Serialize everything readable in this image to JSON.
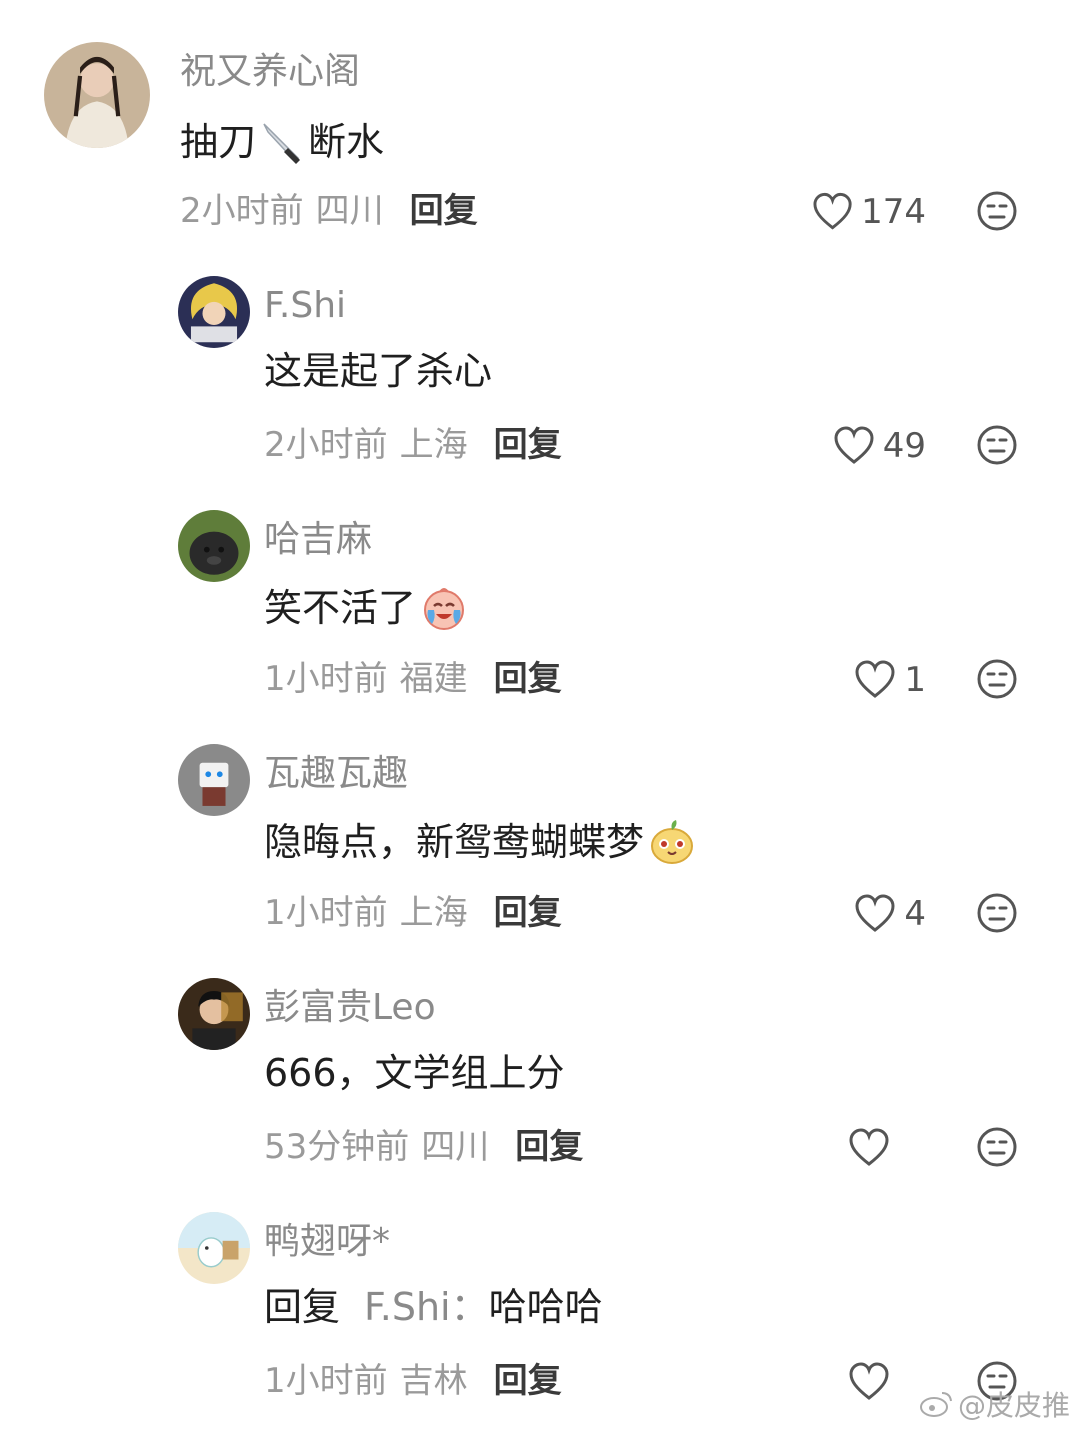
{
  "comments": [
    {
      "username": "祝又养心阁",
      "text": "抽刀",
      "text2": "断水",
      "time": "2小时前",
      "location": "四川",
      "reply_label": "回复",
      "likes": "174"
    },
    {
      "username": "F.Shi",
      "text": "这是起了杀心",
      "time": "2小时前",
      "location": "上海",
      "reply_label": "回复",
      "likes": "49"
    },
    {
      "username": "哈吉麻",
      "text": "笑不活了",
      "time": "1小时前",
      "location": "福建",
      "reply_label": "回复",
      "likes": "1"
    },
    {
      "username": "瓦趣瓦趣",
      "text": "隐晦点，新鸳鸯蝴蝶梦",
      "time": "1小时前",
      "location": "上海",
      "reply_label": "回复",
      "likes": "4"
    },
    {
      "username": "彭富贵Leo",
      "text": "666，文学组上分",
      "time": "53分钟前",
      "location": "四川",
      "reply_label": "回复",
      "likes": ""
    },
    {
      "username": "鸭翅呀*",
      "reply_prefix": "回复",
      "reply_target": "F.Shi：",
      "text": "哈哈哈",
      "time": "1小时前",
      "location": "吉林",
      "reply_label": "回复",
      "likes": ""
    }
  ],
  "icons": {
    "like": "heart-outline-icon",
    "dislike": "neutral-face-icon",
    "knife_emoji": "knife-emoji",
    "laugh_cry_emoji": "laugh-cry-emoji",
    "sly_emoji": "sly-face-emoji"
  },
  "watermark": "@皮皮推"
}
